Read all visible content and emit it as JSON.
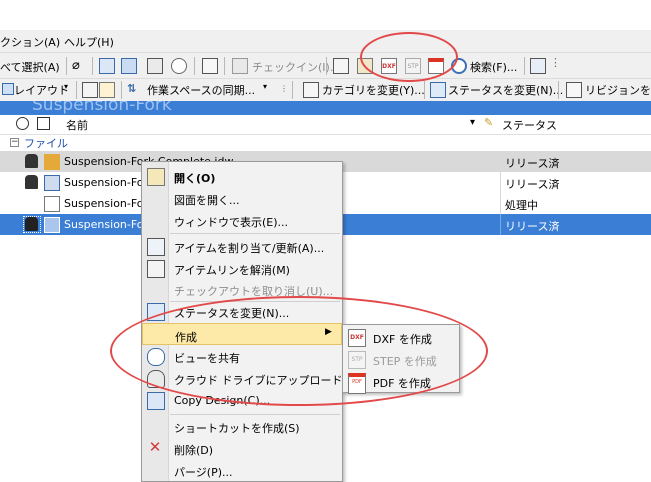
{
  "menubar": {
    "action": "クション(A)",
    "help": "ヘルプ(H)"
  },
  "toolbar1": {
    "select_all": "べて選択(A)",
    "check_in": "チェックイン(I)...",
    "dxf_badge": "DXF",
    "stp_badge": "STP",
    "search": "検索(F)..."
  },
  "toolbar2": {
    "layout": "レイアウト",
    "workspace_sync": "作業スペースの同期...",
    "change_category": "カテゴリを変更(Y)...",
    "change_state": "ステータスを変更(N)...",
    "change_revision": "リビジョンを変更"
  },
  "banner": {
    "title": "Suspension-Fork"
  },
  "columns": {
    "name": "名前",
    "state": "ステータス"
  },
  "group": {
    "label": "ファイル"
  },
  "rows": [
    {
      "name": "Suspension-Fork Complete.idw",
      "status": "リリース済"
    },
    {
      "name": "Suspension-Fo",
      "status": "リリース済"
    },
    {
      "name": "Suspension-Fo",
      "status": "処理中"
    },
    {
      "name": "Suspension-Fo",
      "status": "リリース済"
    }
  ],
  "context_menu": {
    "open": "開く(O)",
    "open_drawing": "図面を開く...",
    "show_window": "ウィンドウで表示(E)...",
    "assign_item": "アイテムを割り当て/更新(A)...",
    "item_wipe": "アイテムリンを解消(M)",
    "undo_checkout": "チェックアウトを取り消し(U)...",
    "change_state": "ステータスを変更(N)...",
    "create": "作成",
    "share_view": "ビューを共有",
    "cloud_upload": "クラウド ドライブにアップロード",
    "copy_design": "Copy Design(C)...",
    "create_shortcut": "ショートカットを作成(S)",
    "delete": "削除(D)",
    "purge": "パージ(P)..."
  },
  "submenu": {
    "dxf": "DXF を作成",
    "step": "STEP を作成",
    "pdf": "PDF を作成",
    "dxf_badge": "DXF",
    "stp_badge": "STP",
    "pdf_badge": "PDF"
  },
  "colors": {
    "selection": "#3b7ed6",
    "annotation": "#e24a4a",
    "highlight": "#fde9a8"
  }
}
